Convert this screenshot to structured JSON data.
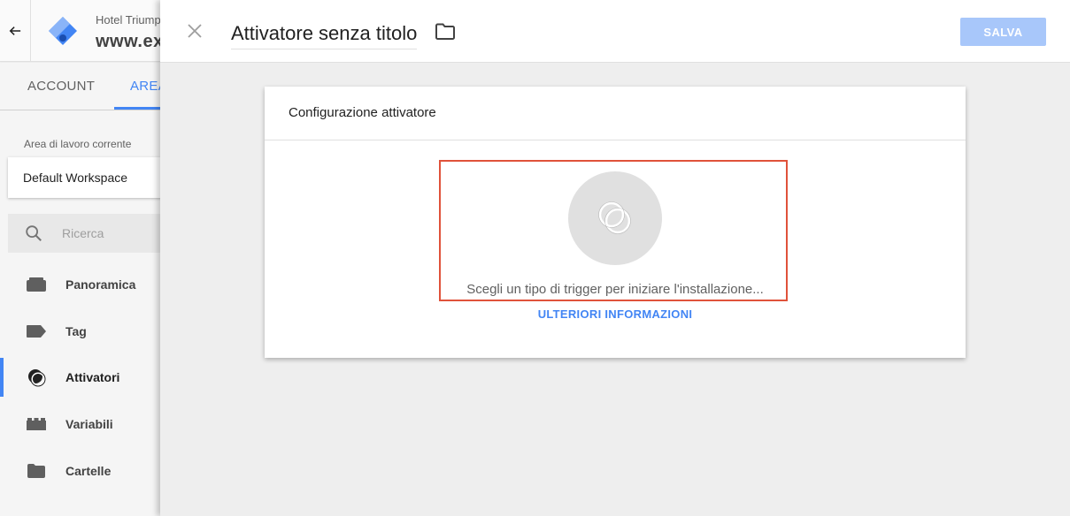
{
  "header": {
    "account_name": "Hotel Triump",
    "container_name": "www.ex"
  },
  "tabs": [
    {
      "label": "ACCOUNT"
    },
    {
      "label": "AREA"
    }
  ],
  "sidebar": {
    "workspace_label": "Area di lavoro corrente",
    "workspace_name": "Default Workspace",
    "search_placeholder": "Ricerca",
    "items": [
      {
        "label": "Panoramica",
        "icon": "overview-icon"
      },
      {
        "label": "Tag",
        "icon": "tag-icon"
      },
      {
        "label": "Attivatori",
        "icon": "trigger-icon",
        "active": true
      },
      {
        "label": "Variabili",
        "icon": "variables-icon"
      },
      {
        "label": "Cartelle",
        "icon": "folder-icon"
      }
    ]
  },
  "panel": {
    "title": "Attivatore senza titolo",
    "save_label": "SALVA",
    "card_title": "Configurazione attivatore",
    "hint": "Scegli un tipo di trigger per iniziare l'installazione...",
    "learn_more": "ULTERIORI INFORMAZIONI"
  },
  "colors": {
    "accent": "#4285f4",
    "save_disabled": "#a8c7fa",
    "highlight": "#e0523a"
  }
}
